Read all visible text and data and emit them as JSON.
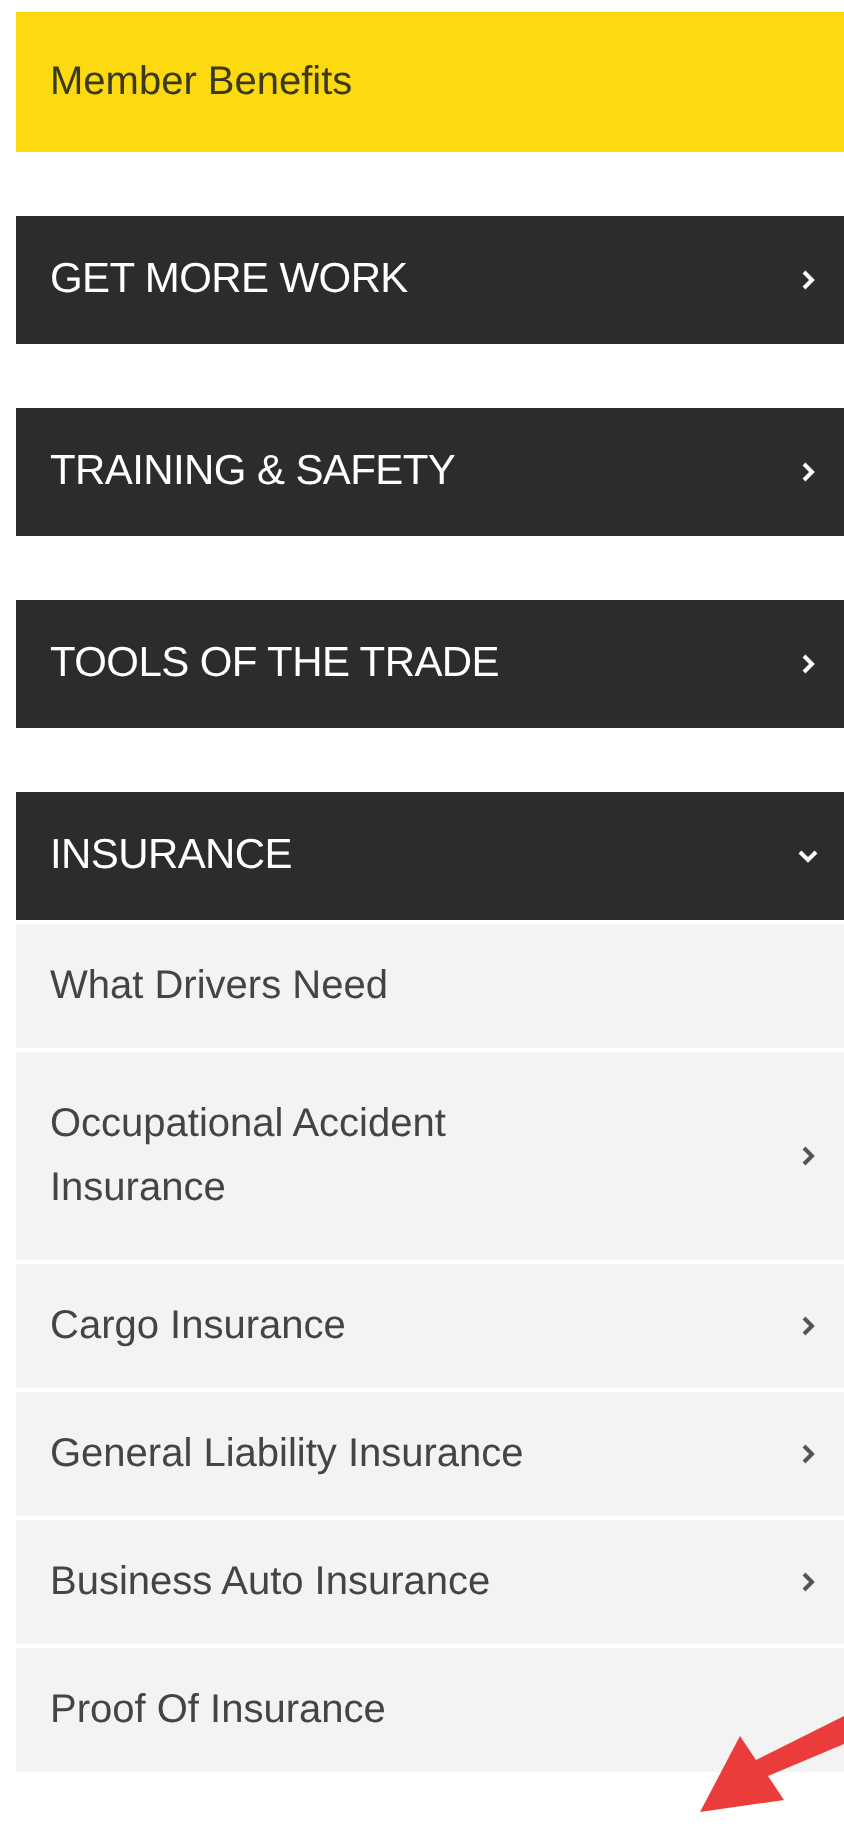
{
  "header": {
    "label": "Member Benefits"
  },
  "sections": [
    {
      "label": "GET MORE WORK",
      "expanded": false
    },
    {
      "label": "TRAINING & SAFETY",
      "expanded": false
    },
    {
      "label": "TOOLS OF THE TRADE",
      "expanded": false
    },
    {
      "label": "INSURANCE",
      "expanded": true,
      "children": [
        {
          "label": "What Drivers Need",
          "has_submenu": false
        },
        {
          "label": "Occupational Accident Insurance",
          "has_submenu": true
        },
        {
          "label": "Cargo Insurance",
          "has_submenu": true
        },
        {
          "label": "General Liability Insurance",
          "has_submenu": true
        },
        {
          "label": "Business Auto Insurance",
          "has_submenu": true
        },
        {
          "label": "Proof Of Insurance",
          "has_submenu": false
        }
      ]
    }
  ]
}
